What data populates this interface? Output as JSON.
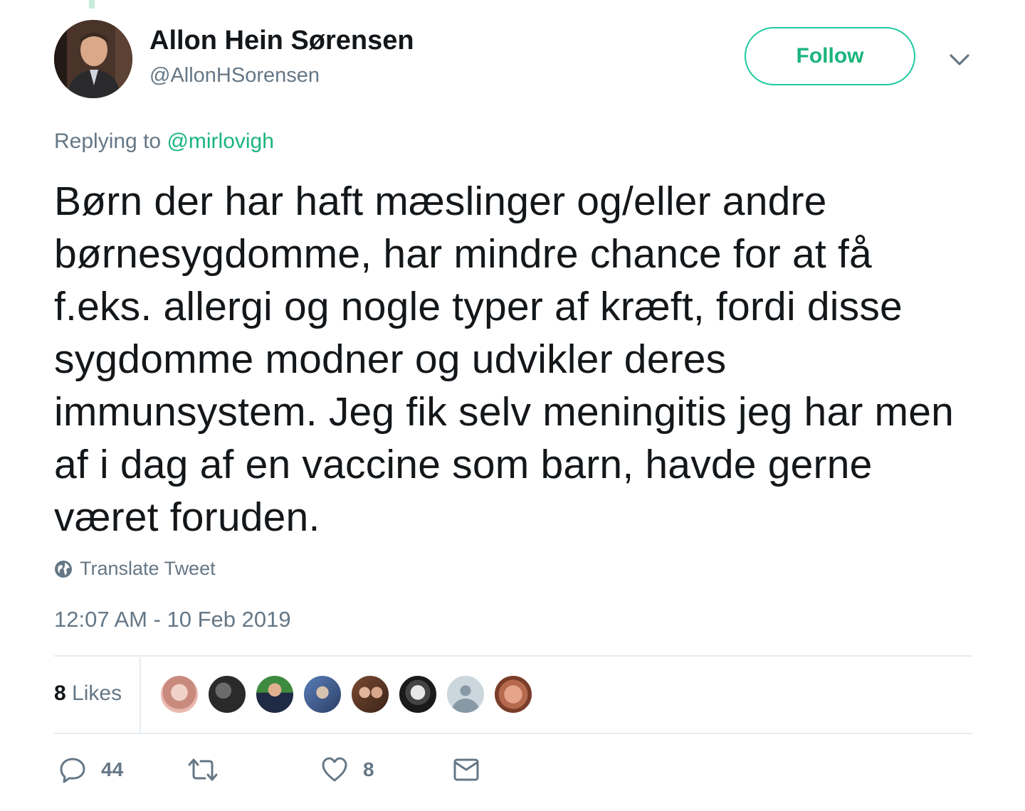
{
  "tweet": {
    "author_name": "Allon Hein Sørensen",
    "author_handle": "@AllonHSorensen",
    "follow_label": "Follow",
    "reply_prefix": "Replying to",
    "reply_to": "@mirlovigh",
    "text": "Børn der har haft mæslinger og/eller andre børnesygdomme, har mindre chance for at få f.eks. allergi og nogle typer af kræft, fordi disse sygdomme modner og udvikler deres immunsystem. Jeg fik selv meningitis jeg har men af i dag af en vaccine som barn, havde gerne været foruden.",
    "translate_label": "Translate Tweet",
    "timestamp": "12:07 AM - 10 Feb 2019"
  },
  "stats": {
    "likes_count": "8",
    "likes_label": "Likes"
  },
  "actions": {
    "reply_count": "44",
    "retweet_count": "",
    "like_count": "8"
  },
  "colors": {
    "accent": "#1ab57d",
    "muted": "#657786",
    "text": "#14171a",
    "divider": "#e6ecf0"
  }
}
